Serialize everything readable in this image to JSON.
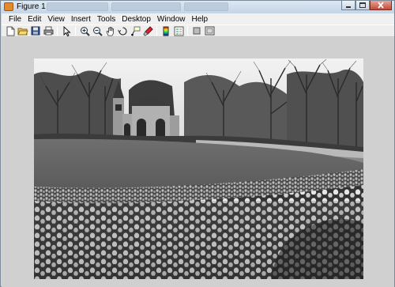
{
  "window": {
    "title": "Figure 1"
  },
  "menu": {
    "items": [
      "File",
      "Edit",
      "View",
      "Insert",
      "Tools",
      "Desktop",
      "Window",
      "Help"
    ]
  },
  "toolbar": {
    "icons": [
      "new-figure-icon",
      "open-file-icon",
      "save-icon",
      "print-icon",
      "edit-plot-icon",
      "zoom-in-icon",
      "zoom-out-icon",
      "pan-icon",
      "rotate-3d-icon",
      "data-cursor-icon",
      "brush-icon",
      "colorbar-icon",
      "legend-icon",
      "hide-plot-tools-icon",
      "show-plot-tools-icon"
    ]
  },
  "colors": {
    "title_bar": "#c4d5e6",
    "menu_bar": "#f0f0f0",
    "figure_bg": "#d0d0d0"
  },
  "image": {
    "description_key": "grayscale-park-photo",
    "colormap": "gray"
  }
}
